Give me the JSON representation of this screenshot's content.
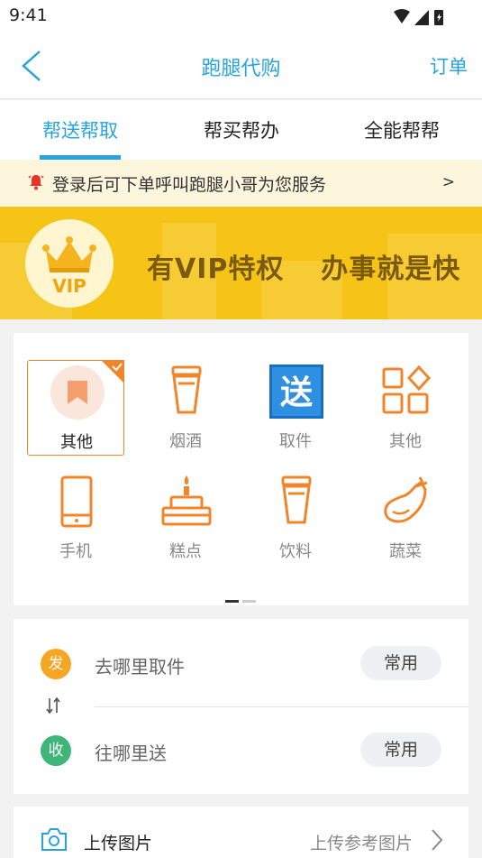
{
  "status_bar": {
    "time": "9:41"
  },
  "nav": {
    "title": "跑腿代购",
    "orders_label": "订单"
  },
  "tabs": [
    {
      "label": "帮送帮取",
      "active": true
    },
    {
      "label": "帮买帮办",
      "active": false
    },
    {
      "label": "全能帮帮",
      "active": false
    }
  ],
  "notice": {
    "text": "登录后可下单呼叫跑腿小哥为您服务",
    "arrow": ">"
  },
  "banner": {
    "badge": "VIP",
    "slogan_part1": "有VIP特权",
    "slogan_part2": "办事就是快",
    "color": "#f6c417"
  },
  "categories": [
    {
      "label": "其他",
      "icon": "bookmark-icon",
      "selected": true
    },
    {
      "label": "烟酒",
      "icon": "cup-icon",
      "selected": false
    },
    {
      "label": "取件",
      "icon": "delivery-icon",
      "selected": false
    },
    {
      "label": "其他",
      "icon": "grid-icon",
      "selected": false
    },
    {
      "label": "手机",
      "icon": "phone-icon",
      "selected": false
    },
    {
      "label": "糕点",
      "icon": "cake-icon",
      "selected": false
    },
    {
      "label": "饮料",
      "icon": "drink-icon",
      "selected": false
    },
    {
      "label": "蔬菜",
      "icon": "eggplant-icon",
      "selected": false
    }
  ],
  "pager": {
    "pages": 2,
    "current": 1
  },
  "address": {
    "from": {
      "badge": "发",
      "hint": "去哪里取件",
      "common": "常用",
      "color": "#f5a623"
    },
    "to": {
      "badge": "收",
      "hint": "往哪里送",
      "common": "常用",
      "color": "#3fb57a"
    }
  },
  "upload": {
    "label": "上传图片",
    "hint": "上传参考图片"
  },
  "colors": {
    "accent": "#27a3dd",
    "orange": "#f0852a"
  }
}
